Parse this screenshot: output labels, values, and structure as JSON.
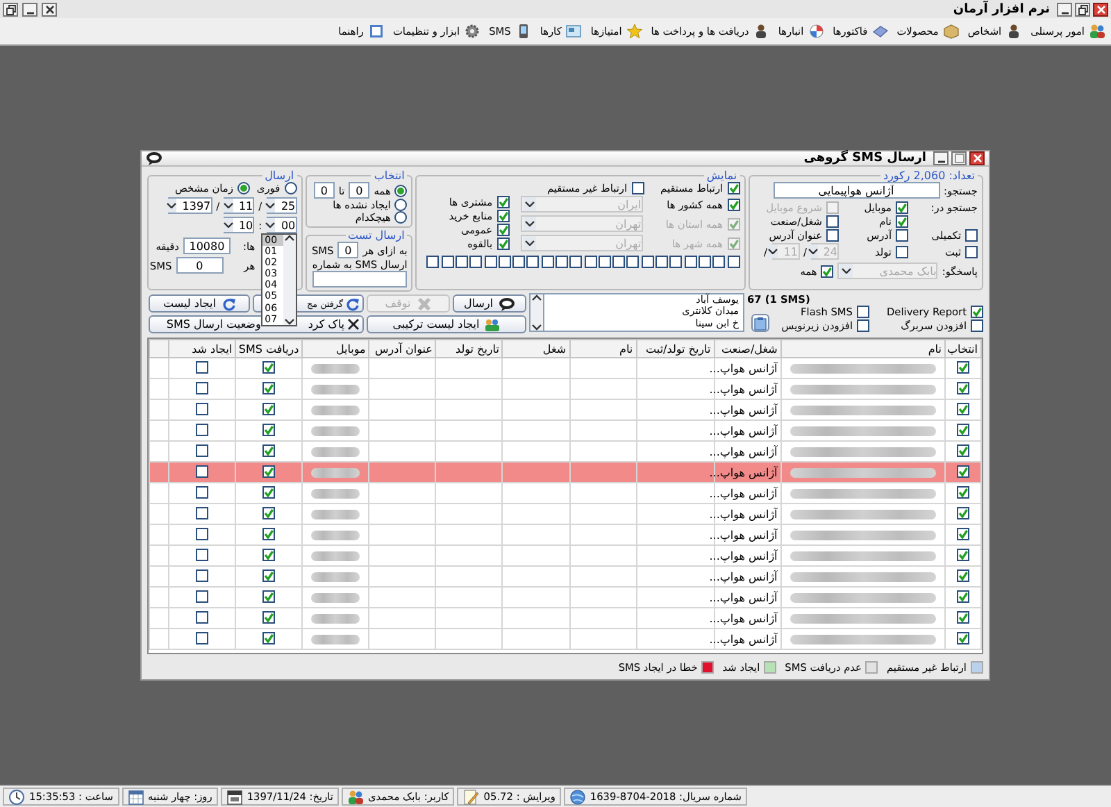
{
  "app": {
    "title": "نرم افزار آرمان"
  },
  "menu": [
    {
      "label": "امور پرسنلی"
    },
    {
      "label": "اشخاص"
    },
    {
      "label": "محصولات"
    },
    {
      "label": "فاکتورها"
    },
    {
      "label": "انبارها"
    },
    {
      "label": "دریافت ها و پرداخت ها"
    },
    {
      "label": "امتیازها"
    },
    {
      "label": "کارها"
    },
    {
      "label": "SMS"
    },
    {
      "label": "ابزار و تنظیمات"
    },
    {
      "label": "راهنما"
    }
  ],
  "dialog": {
    "title": "ارسال SMS گروهی"
  },
  "search": {
    "legend": "تعداد: 2,060 رکورد",
    "label": "جستجو:",
    "value": "آژانس هواپیمایی",
    "in_label": "جستجو در:",
    "options": [
      {
        "label": "موبایل",
        "checked": true,
        "disabled": false
      },
      {
        "label": "شروع موبایل",
        "checked": false,
        "disabled": true
      },
      {
        "label": "نام",
        "checked": true,
        "disabled": false
      },
      {
        "label": "شغل/صنعت",
        "checked": false,
        "disabled": false
      },
      {
        "label": "تکمیلی",
        "checked": false,
        "disabled": false
      },
      {
        "label": "آدرس",
        "checked": false,
        "disabled": false
      },
      {
        "label": "عنوان آدرس",
        "checked": false,
        "disabled": false
      },
      {
        "label": "ثبت",
        "checked": false,
        "disabled": false
      },
      {
        "label": "تولد",
        "checked": false,
        "disabled": false
      }
    ],
    "date": [
      "24",
      "/",
      "11",
      "/"
    ],
    "responder_label": "پاسخگو:",
    "responder": "بابک محمدی",
    "all": {
      "label": "همه",
      "checked": true
    }
  },
  "filter": {
    "legend": "نمایش",
    "links": [
      {
        "label": "ارتباط مستقیم",
        "checked": true
      },
      {
        "label": "ارتباط غیر مستقیم",
        "checked": false
      }
    ],
    "regions": [
      {
        "label": "همه کشور ها",
        "checked": true,
        "disabled": false,
        "value": "ایران"
      },
      {
        "label": "همه استان ها",
        "checked": true,
        "disabled": true,
        "value": "تهران"
      },
      {
        "label": "همه شهر ها",
        "checked": true,
        "disabled": true,
        "value": "تهران"
      }
    ],
    "types": [
      {
        "label": "مشتری ها",
        "checked": true
      },
      {
        "label": "منابع خرید",
        "checked": true
      },
      {
        "label": "عمومی",
        "checked": true
      },
      {
        "label": "بالقوه",
        "checked": true
      }
    ],
    "color_boxes": [
      {
        "checked": false
      },
      {
        "checked": false
      },
      {
        "checked": false
      },
      {
        "checked": false
      },
      {
        "checked": false
      },
      {
        "checked": false
      },
      {
        "checked": false
      },
      {
        "checked": false
      },
      {
        "checked": false
      },
      {
        "checked": false
      },
      {
        "checked": false
      },
      {
        "checked": false
      },
      {
        "checked": false
      },
      {
        "checked": false
      },
      {
        "checked": false
      },
      {
        "checked": false
      },
      {
        "checked": false
      },
      {
        "checked": false
      },
      {
        "checked": false
      },
      {
        "checked": false
      },
      {
        "checked": false
      },
      {
        "checked": false
      }
    ]
  },
  "selection": {
    "legend": "انتخاب",
    "options": [
      {
        "label": "همه",
        "selected": true
      },
      {
        "label": "ایجاد نشده ها",
        "selected": false
      },
      {
        "label": "هیچکدام",
        "selected": false
      }
    ],
    "from": "0",
    "to_label": "تا",
    "to": "0"
  },
  "test": {
    "legend": "ارسال تست",
    "per_label": "به ازای هر",
    "per": "0",
    "unit": "SMS",
    "number_label": "ارسال SMS به شماره"
  },
  "send": {
    "legend": "ارسال",
    "modes": [
      {
        "label": "فوری",
        "selected": false
      },
      {
        "label": "زمان مشخص",
        "selected": true
      }
    ],
    "date": [
      "25",
      "/",
      "11",
      "/",
      "1397"
    ],
    "time": [
      "00",
      ":",
      "10"
    ],
    "interval_label": "ها:",
    "interval": "10080",
    "interval_unit": "دقیقه",
    "every_label": "هر",
    "every": "0",
    "every_unit": "SMS",
    "dropdown": [
      {
        "label": "00",
        "selected": true
      },
      {
        "label": "01",
        "selected": false
      },
      {
        "label": "02",
        "selected": false
      },
      {
        "label": "03",
        "selected": false
      },
      {
        "label": "04",
        "selected": false
      },
      {
        "label": "05",
        "selected": false
      },
      {
        "label": "06",
        "selected": false
      },
      {
        "label": "07",
        "selected": false
      }
    ]
  },
  "message": {
    "count": "67 (1 SMS)",
    "options": [
      {
        "label": "Delivery Report",
        "checked": true
      },
      {
        "label": "Flash SMS",
        "checked": false
      },
      {
        "label": "افزودن سربرگ",
        "checked": false
      },
      {
        "label": "افزودن زیرنویس",
        "checked": false
      }
    ],
    "lines": [
      "یوسف آباد",
      "میدان کلانتری",
      "خ ابن سینا"
    ]
  },
  "buttons": [
    {
      "label": "ارسال",
      "disabled": false
    },
    {
      "label": "توقف",
      "disabled": true
    },
    {
      "label": "گرفتن مج",
      "disabled": false
    },
    {
      "label": "ایجاد لیست",
      "disabled": false
    },
    {
      "label": "ایجاد لیست ترکیبی",
      "disabled": false
    },
    {
      "label": "پاک کرد",
      "label_2": "وضعیت ارسال SMS",
      "disabled": false
    }
  ],
  "table": {
    "columns": [
      "انتخاب",
      "نام",
      "شغل/صنعت",
      "تاریخ تولد/ثبت",
      "نام",
      "شغل",
      "تاریخ تولد",
      "عنوان آدرس",
      "موبایل",
      "دریافت SMS",
      "ایجاد شد"
    ],
    "rows": [
      {
        "selected": true,
        "job": "آژانس هواپ...",
        "sms_received": true,
        "created": false,
        "color": "#ffffff"
      },
      {
        "selected": true,
        "job": "آژانس هواپ...",
        "sms_received": true,
        "created": false,
        "color": "#ffffff"
      },
      {
        "selected": true,
        "job": "آژانس هواپ...",
        "sms_received": true,
        "created": false,
        "color": "#ffffff"
      },
      {
        "selected": true,
        "job": "آژانس هواپ...",
        "sms_received": true,
        "created": false,
        "color": "#ffffff"
      },
      {
        "selected": true,
        "job": "آژانس هواپ...",
        "sms_received": true,
        "created": false,
        "color": "#ffffff"
      },
      {
        "selected": true,
        "job": "آژانس هواپ...",
        "sms_received": true,
        "created": false,
        "color": "#f28a8a"
      },
      {
        "selected": true,
        "job": "آژانس هواپ...",
        "sms_received": true,
        "created": false,
        "color": "#ffffff"
      },
      {
        "selected": true,
        "job": "آژانس هواپ...",
        "sms_received": true,
        "created": false,
        "color": "#ffffff"
      },
      {
        "selected": true,
        "job": "آژانس هواپ...",
        "sms_received": true,
        "created": false,
        "color": "#ffffff"
      },
      {
        "selected": true,
        "job": "آژانس هواپ...",
        "sms_received": true,
        "created": false,
        "color": "#ffffff"
      },
      {
        "selected": true,
        "job": "آژانس هواپ...",
        "sms_received": true,
        "created": false,
        "color": "#ffffff"
      },
      {
        "selected": true,
        "job": "آژانس هواپ...",
        "sms_received": true,
        "created": false,
        "color": "#ffffff"
      },
      {
        "selected": true,
        "job": "آژانس هواپ...",
        "sms_received": true,
        "created": false,
        "color": "#ffffff"
      },
      {
        "selected": true,
        "job": "آژانس هواپ...",
        "sms_received": true,
        "created": false,
        "color": "#ffffff"
      }
    ]
  },
  "legend": [
    {
      "label": "ارتباط غیر مستقیم",
      "color": "#b9d1ec"
    },
    {
      "label": "عدم دریافت SMS",
      "color": "#e2e2e2"
    },
    {
      "label": "ایجاد شد",
      "color": "#b6e2b6"
    },
    {
      "label": "خطا در ایجاد SMS",
      "color": "#e0102e"
    }
  ],
  "status_bar": [
    {
      "kind": "serial",
      "label": "شماره سریال: 2018-8704-1639"
    },
    {
      "kind": "edit",
      "label": "ویرایش : 05.72"
    },
    {
      "kind": "user",
      "label": "کاربر: بابک محمدی"
    },
    {
      "kind": "date",
      "label": "تاریخ: 1397/11/24"
    },
    {
      "kind": "calendar",
      "label": "روز: چهار شنبه"
    },
    {
      "kind": "clock",
      "label": "ساعت : 15:35:53"
    }
  ]
}
